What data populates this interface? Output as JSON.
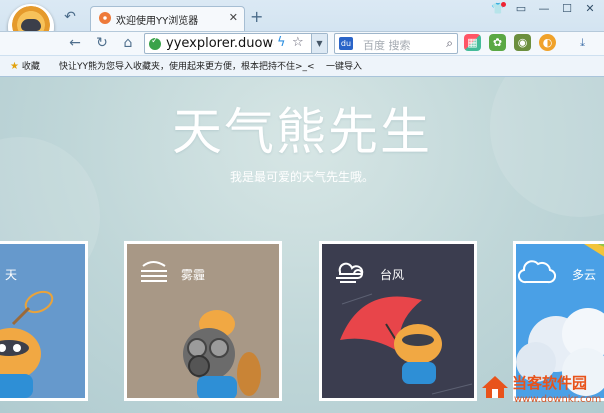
{
  "browser": {
    "tab": {
      "title": "欢迎使用YY浏览器",
      "close": "✕"
    },
    "new_tab": "+",
    "address": "yyexplorer.duowan",
    "search_placeholder": "百度 搜索",
    "bookmarks": [
      {
        "icon": "★",
        "label": "收藏"
      },
      {
        "label": "快让YY熊为您导入收藏夹，使用起来更方便，根本把持不住>_<"
      },
      {
        "label": "一键导入"
      }
    ]
  },
  "page": {
    "title": "天气熊先生",
    "subtitle": "我是最可爱的天气先生哦。"
  },
  "cards": [
    {
      "label": "天",
      "color": "#6699cc"
    },
    {
      "label": "雾霾",
      "color": "#a89886"
    },
    {
      "label": "台风",
      "color": "#3b3d4f"
    },
    {
      "label": "多云",
      "color": "#4aa0e6"
    }
  ],
  "watermark": {
    "main": "当客软件园",
    "sub": "www.downkr.com"
  },
  "icons": [
    "yy-avatar",
    "back-icon",
    "refresh-icon",
    "home-icon",
    "security-shield-icon",
    "bolt-icon",
    "star-icon",
    "baidu-paw-icon",
    "search-icon",
    "apps-icon",
    "puzzle-icon",
    "download-icon"
  ]
}
